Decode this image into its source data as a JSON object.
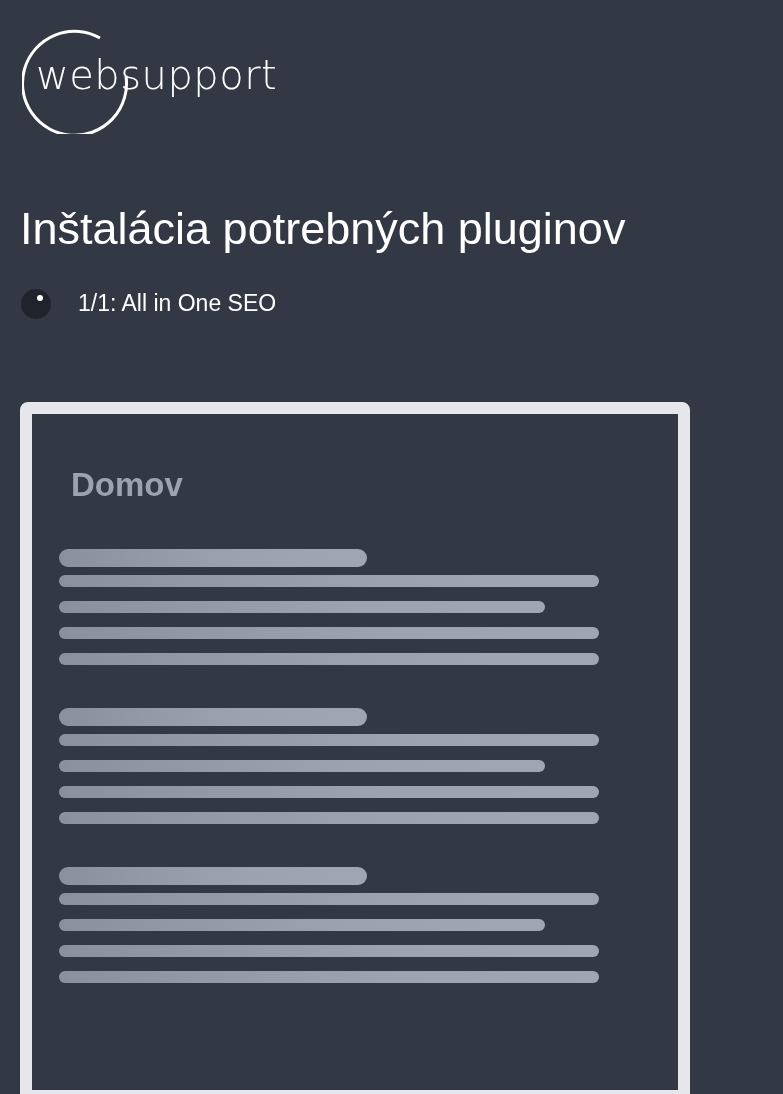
{
  "logo": {
    "text": "websupport"
  },
  "title": "Inštalácia potrebných pluginov",
  "progress": {
    "text": "1/1: All in One SEO"
  },
  "preview": {
    "title": "Domov"
  }
}
